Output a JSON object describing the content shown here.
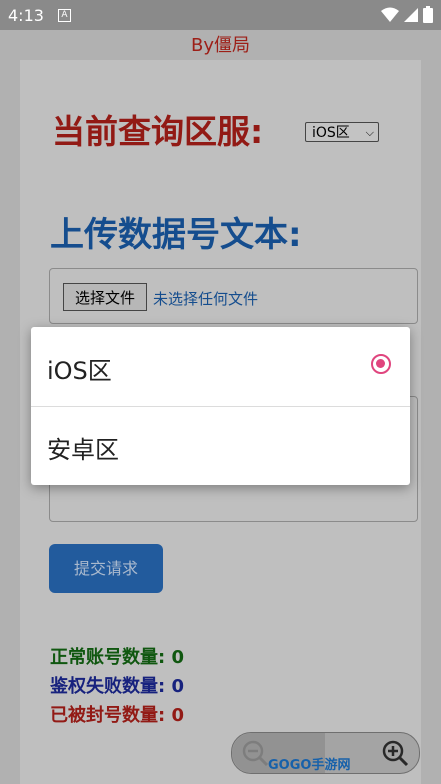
{
  "status_bar": {
    "time": "4:13",
    "notification": "A"
  },
  "top_bar": {
    "title": "By僵局"
  },
  "form": {
    "region_heading": "当前查询区服:",
    "region_select_value": "iOS区",
    "upload_heading": "上传数据号文本:",
    "file_button": "选择文件",
    "file_status": "未选择任何文件",
    "submit_label": "提交请求"
  },
  "stats": [
    {
      "label": "正常账号数量:",
      "value": "0",
      "color": "#146b14"
    },
    {
      "label": "鉴权失败数量:",
      "value": "0",
      "color": "#1d2a9a"
    },
    {
      "label": "已被封号数量:",
      "value": "0",
      "color": "#b3201a"
    }
  ],
  "zoom": {
    "out_icon": "zoom-out-icon",
    "in_icon": "zoom-in-icon"
  },
  "watermark": {
    "brand": "GOGO手游网"
  },
  "dialog": {
    "options": [
      {
        "label": "iOS区",
        "selected": true
      },
      {
        "label": "安卓区",
        "selected": false
      }
    ],
    "accent": "#e0457e"
  }
}
